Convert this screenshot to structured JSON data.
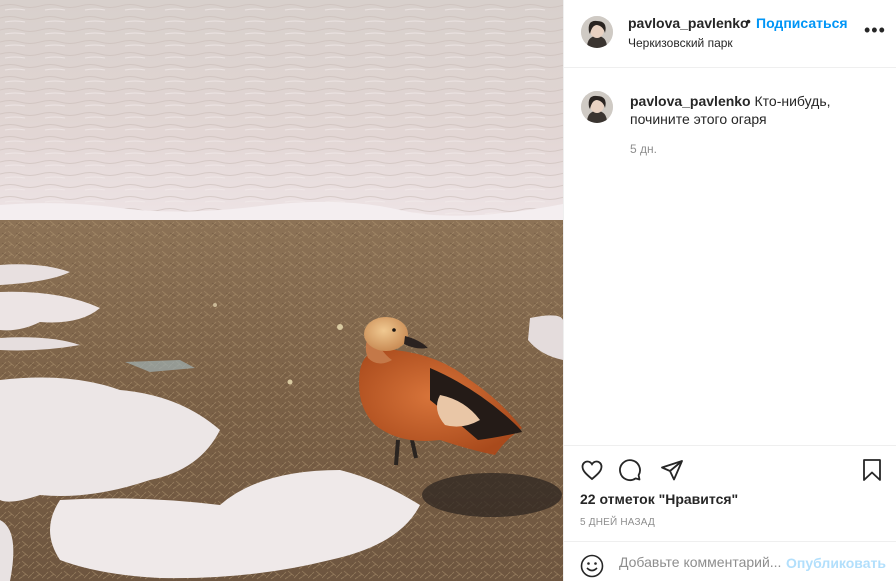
{
  "post": {
    "username": "pavlova_pavlenko",
    "separator": "•",
    "follow_label": "Подписаться",
    "location": "Черкизовский парк",
    "more_label": "•••",
    "caption": "Кто-нибудь, почините этого огаря",
    "caption_time": "5 дн.",
    "likes": "22 отметок \"Нравится\"",
    "date": "5 ДНЕЙ НАЗАД",
    "comment_placeholder": "Добавьте комментарий...",
    "publish_label": "Опубликовать"
  },
  "icons": {
    "like": "heart-icon",
    "comment": "comment-icon",
    "share": "paper-plane-icon",
    "save": "bookmark-icon",
    "emoji": "emoji-icon"
  },
  "colors": {
    "link_blue": "#0095f6",
    "disabled_blue": "#b2dffc",
    "text": "#262626",
    "muted": "#8e8e8e",
    "border": "#efefef"
  }
}
